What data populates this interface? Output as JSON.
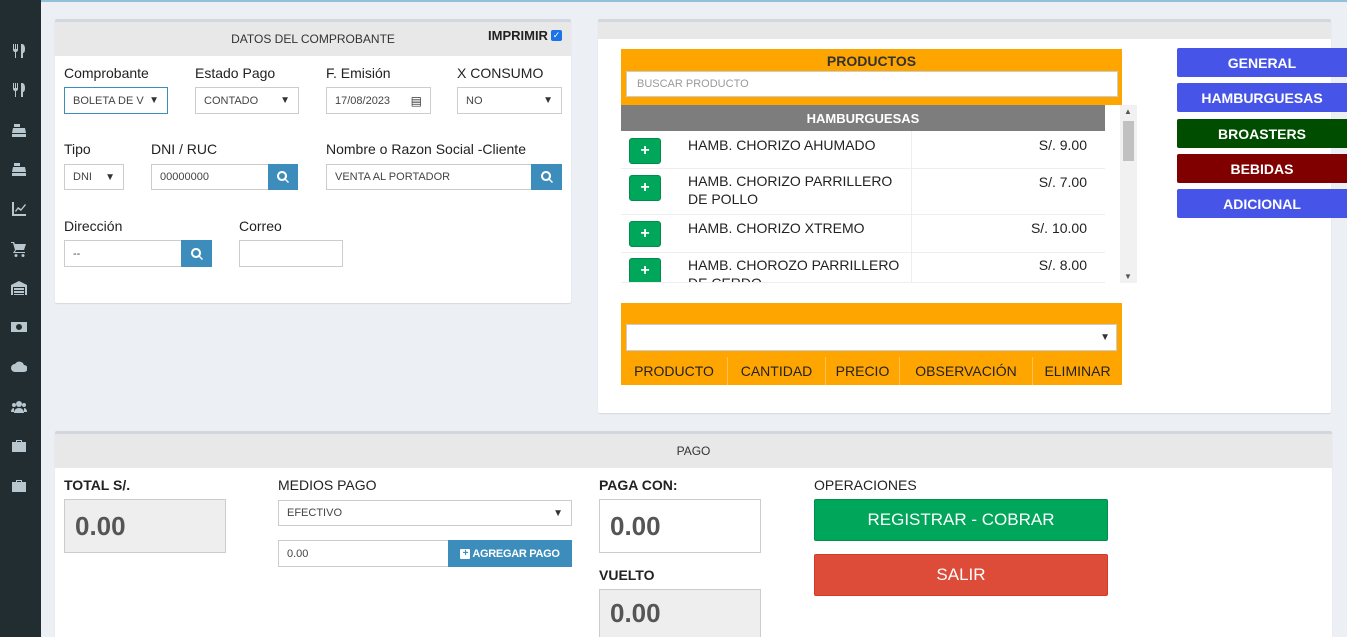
{
  "comprobante": {
    "header": "DATOS DEL COMPROBANTE",
    "imprimir_label": "IMPRIMIR",
    "labels": {
      "comprobante": "Comprobante",
      "estado_pago": "Estado Pago",
      "f_emision": "F. Emisión",
      "x_consumo": "X CONSUMO",
      "tipo": "Tipo",
      "dni_ruc": "DNI / RUC",
      "nombre": "Nombre o Razon Social -Cliente",
      "direccion": "Dirección",
      "correo": "Correo"
    },
    "values": {
      "comprobante": "BOLETA DE V",
      "estado_pago": "CONTADO",
      "f_emision": "17/08/2023",
      "x_consumo": "NO",
      "tipo": "DNI",
      "dni_ruc": "00000000",
      "nombre": "VENTA AL PORTADOR",
      "direccion": "--",
      "correo": ""
    }
  },
  "productos": {
    "title": "PRODUCTOS",
    "search_placeholder": "BUSCAR PRODUCTO",
    "category": "HAMBURGUESAS",
    "add_label": "+",
    "items": [
      {
        "name": "HAMB. CHORIZO AHUMADO",
        "price": "S/. 9.00"
      },
      {
        "name": "HAMB. CHORIZO PARRILLERO DE POLLO",
        "price": "S/. 7.00"
      },
      {
        "name": "HAMB. CHORIZO XTREMO",
        "price": "S/. 10.00"
      },
      {
        "name": "HAMB. CHOROZO PARRILLERO DE CERDO",
        "price": "S/. 8.00"
      }
    ]
  },
  "order": {
    "columns": [
      "PRODUCTO",
      "CANTIDAD",
      "PRECIO",
      "OBSERVACIÓN",
      "ELIMINAR"
    ]
  },
  "categories": [
    {
      "label": "GENERAL",
      "color": "#4655e8"
    },
    {
      "label": "HAMBURGUESAS",
      "color": "#4655e8"
    },
    {
      "label": "BROASTERS",
      "color": "#004d00"
    },
    {
      "label": "BEBIDAS",
      "color": "#800000"
    },
    {
      "label": "ADICIONAL",
      "color": "#4655e8"
    }
  ],
  "pago": {
    "header": "PAGO",
    "total_label": "TOTAL S/.",
    "total_value": "0.00",
    "medios_label": "MEDIOS PAGO",
    "medio_value": "EFECTIVO",
    "monto_value": "0.00",
    "agregar_label": "AGREGAR PAGO",
    "paga_con_label": "PAGA CON:",
    "paga_con_value": "0.00",
    "vuelto_label": "VUELTO",
    "vuelto_value": "0.00",
    "operaciones_label": "OPERACIONES",
    "registrar_label": "REGISTRAR - COBRAR",
    "salir_label": "SALIR"
  },
  "sidebar_icons": [
    "utensils-icon",
    "utensils-icon",
    "cash-register-icon",
    "cash-register-icon",
    "chart-line-icon",
    "cart-icon",
    "warehouse-icon",
    "money-icon",
    "cloud-upload-icon",
    "users-icon",
    "toolbox-icon",
    "toolbox-icon"
  ]
}
